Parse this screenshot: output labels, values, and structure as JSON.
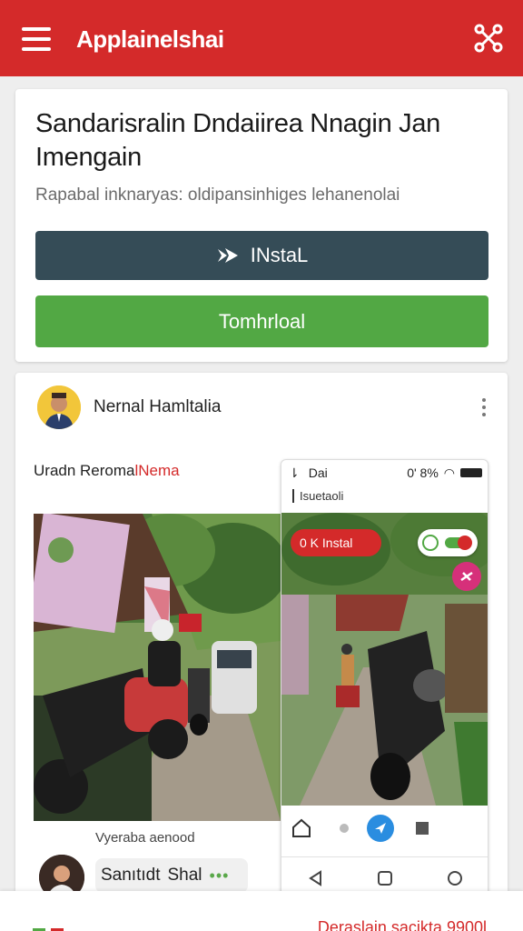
{
  "app_bar": {
    "title": "Applainelshai",
    "menu_icon": "hamburger-menu-icon",
    "share_icon": "share-nodes-icon",
    "color": "#d42a2a"
  },
  "promo_card": {
    "headline": "Sandarisralin Dndaiirea Nnagin Jan Imengain",
    "subtext": "Rapabal inknaryas: oldipansinhiges lehanenolai",
    "install_button": "INstaL",
    "install_icon": "share-arrow-icon",
    "download_button": "Tomhrloal",
    "install_color": "#354c57",
    "download_color": "#52a844"
  },
  "post": {
    "author": "Nernal Hamltalia",
    "caption_plain": "Uradn Reroma",
    "caption_highlight": "lNema",
    "photo_caption": "Vyeraba aenood",
    "comment_author": "Sanıtıdt",
    "comment_text": "Shal",
    "comment_dots": "•••"
  },
  "phone": {
    "status_left": "Dai",
    "status_right": "0' 8%",
    "url_bar": "Isuetaoli",
    "install_pill": "0 K Instal",
    "accent_pink": "#d6307a",
    "accent_blue": "#2a8de0"
  },
  "bottom_sheet": {
    "text": "Deraslain sacikta 9900l"
  }
}
